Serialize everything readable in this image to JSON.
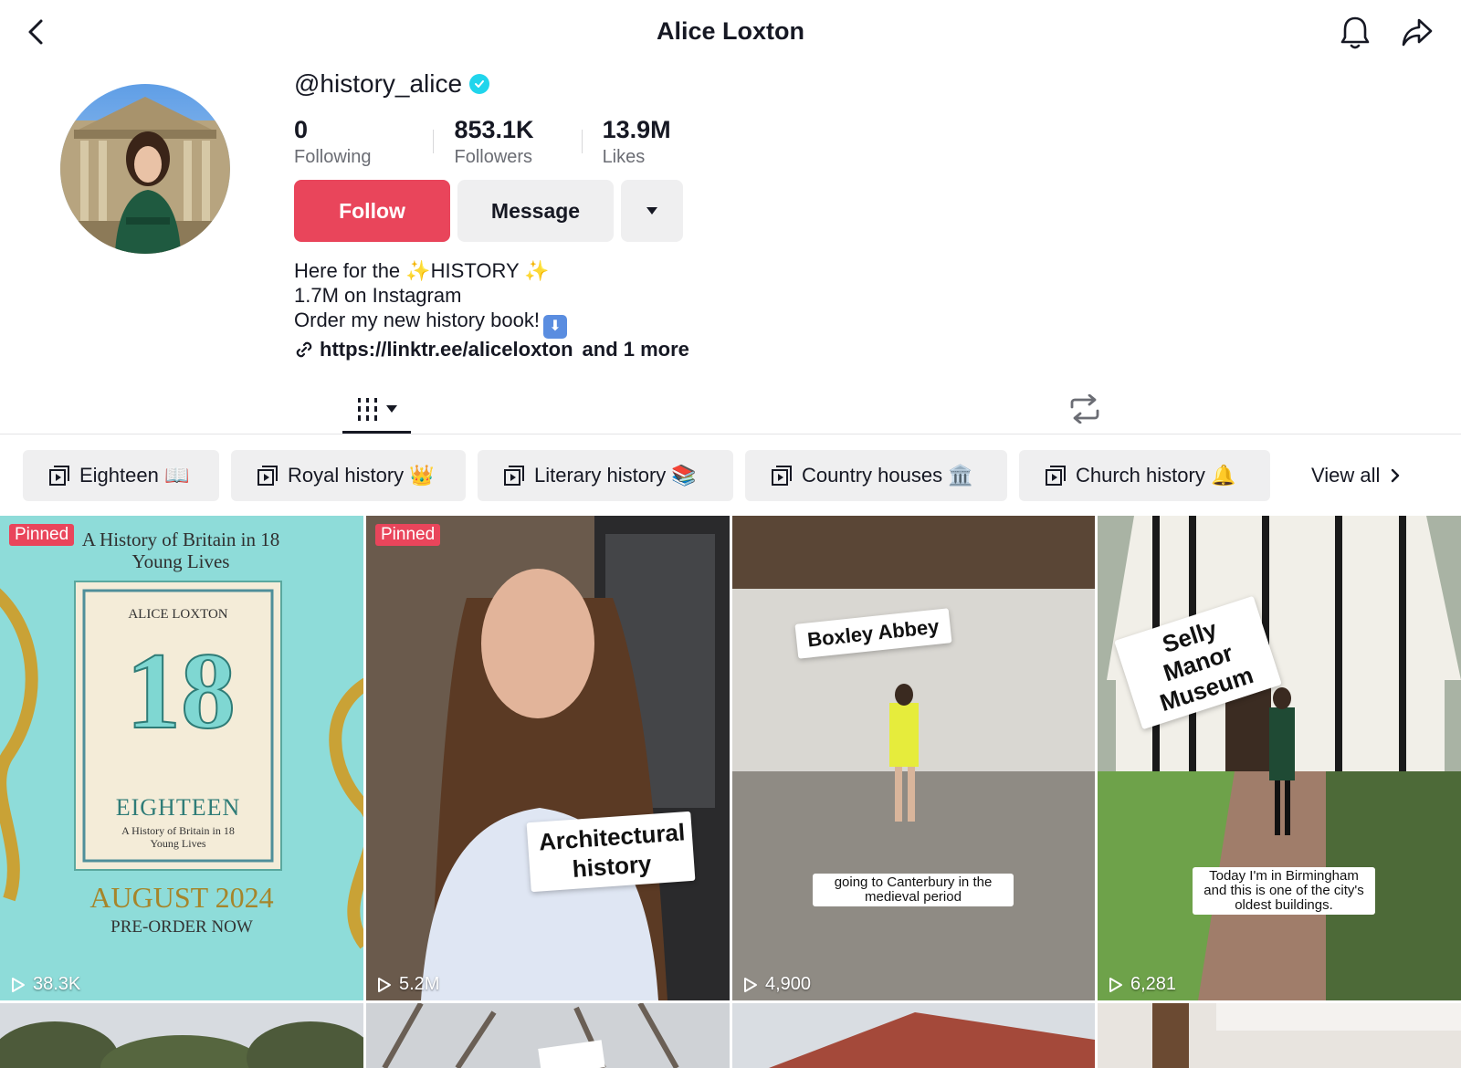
{
  "header": {
    "title": "Alice Loxton"
  },
  "profile": {
    "username": "@history_alice",
    "verified": true,
    "stats": [
      {
        "value": "0",
        "label": "Following"
      },
      {
        "value": "853.1K",
        "label": "Followers"
      },
      {
        "value": "13.9M",
        "label": "Likes"
      }
    ],
    "follow_label": "Follow",
    "message_label": "Message",
    "bio_lines": [
      "Here for the ✨HISTORY ✨",
      "1.7M on Instagram",
      "Order my new history book!"
    ],
    "link": "https://linktr.ee/aliceloxton",
    "link_more": "and 1 more"
  },
  "playlists": [
    {
      "label": "Eighteen 📖"
    },
    {
      "label": "Royal history 👑"
    },
    {
      "label": "Literary history 📚"
    },
    {
      "label": "Country houses 🏛️"
    },
    {
      "label": "Church history 🔔"
    }
  ],
  "view_all_label": "View all",
  "videos": [
    {
      "pinned_label": "Pinned",
      "views": "38.3K",
      "overlay_title": "A History of Britain in 18 Young Lives",
      "book_author": "ALICE LOXTON",
      "book_number": "18",
      "book_title": "EIGHTEEN",
      "book_subtitle": "A History of Britain in 18 Young Lives",
      "release": "AUGUST 2024",
      "preorder": "PRE-ORDER NOW"
    },
    {
      "pinned_label": "Pinned",
      "views": "5.2M",
      "sticker": "Architectural history"
    },
    {
      "views": "4,900",
      "sticker": "Boxley Abbey",
      "caption": "going to Canterbury in the medieval period"
    },
    {
      "views": "6,281",
      "sticker": "Selly Manor Museum",
      "caption": "Today I'm in Birmingham and this is one of the city's oldest buildings."
    }
  ],
  "colors": {
    "accent": "#e9455b",
    "verified": "#20d5ec",
    "text": "#161823",
    "muted": "#6b6d74",
    "chip_bg": "#efeff0"
  }
}
